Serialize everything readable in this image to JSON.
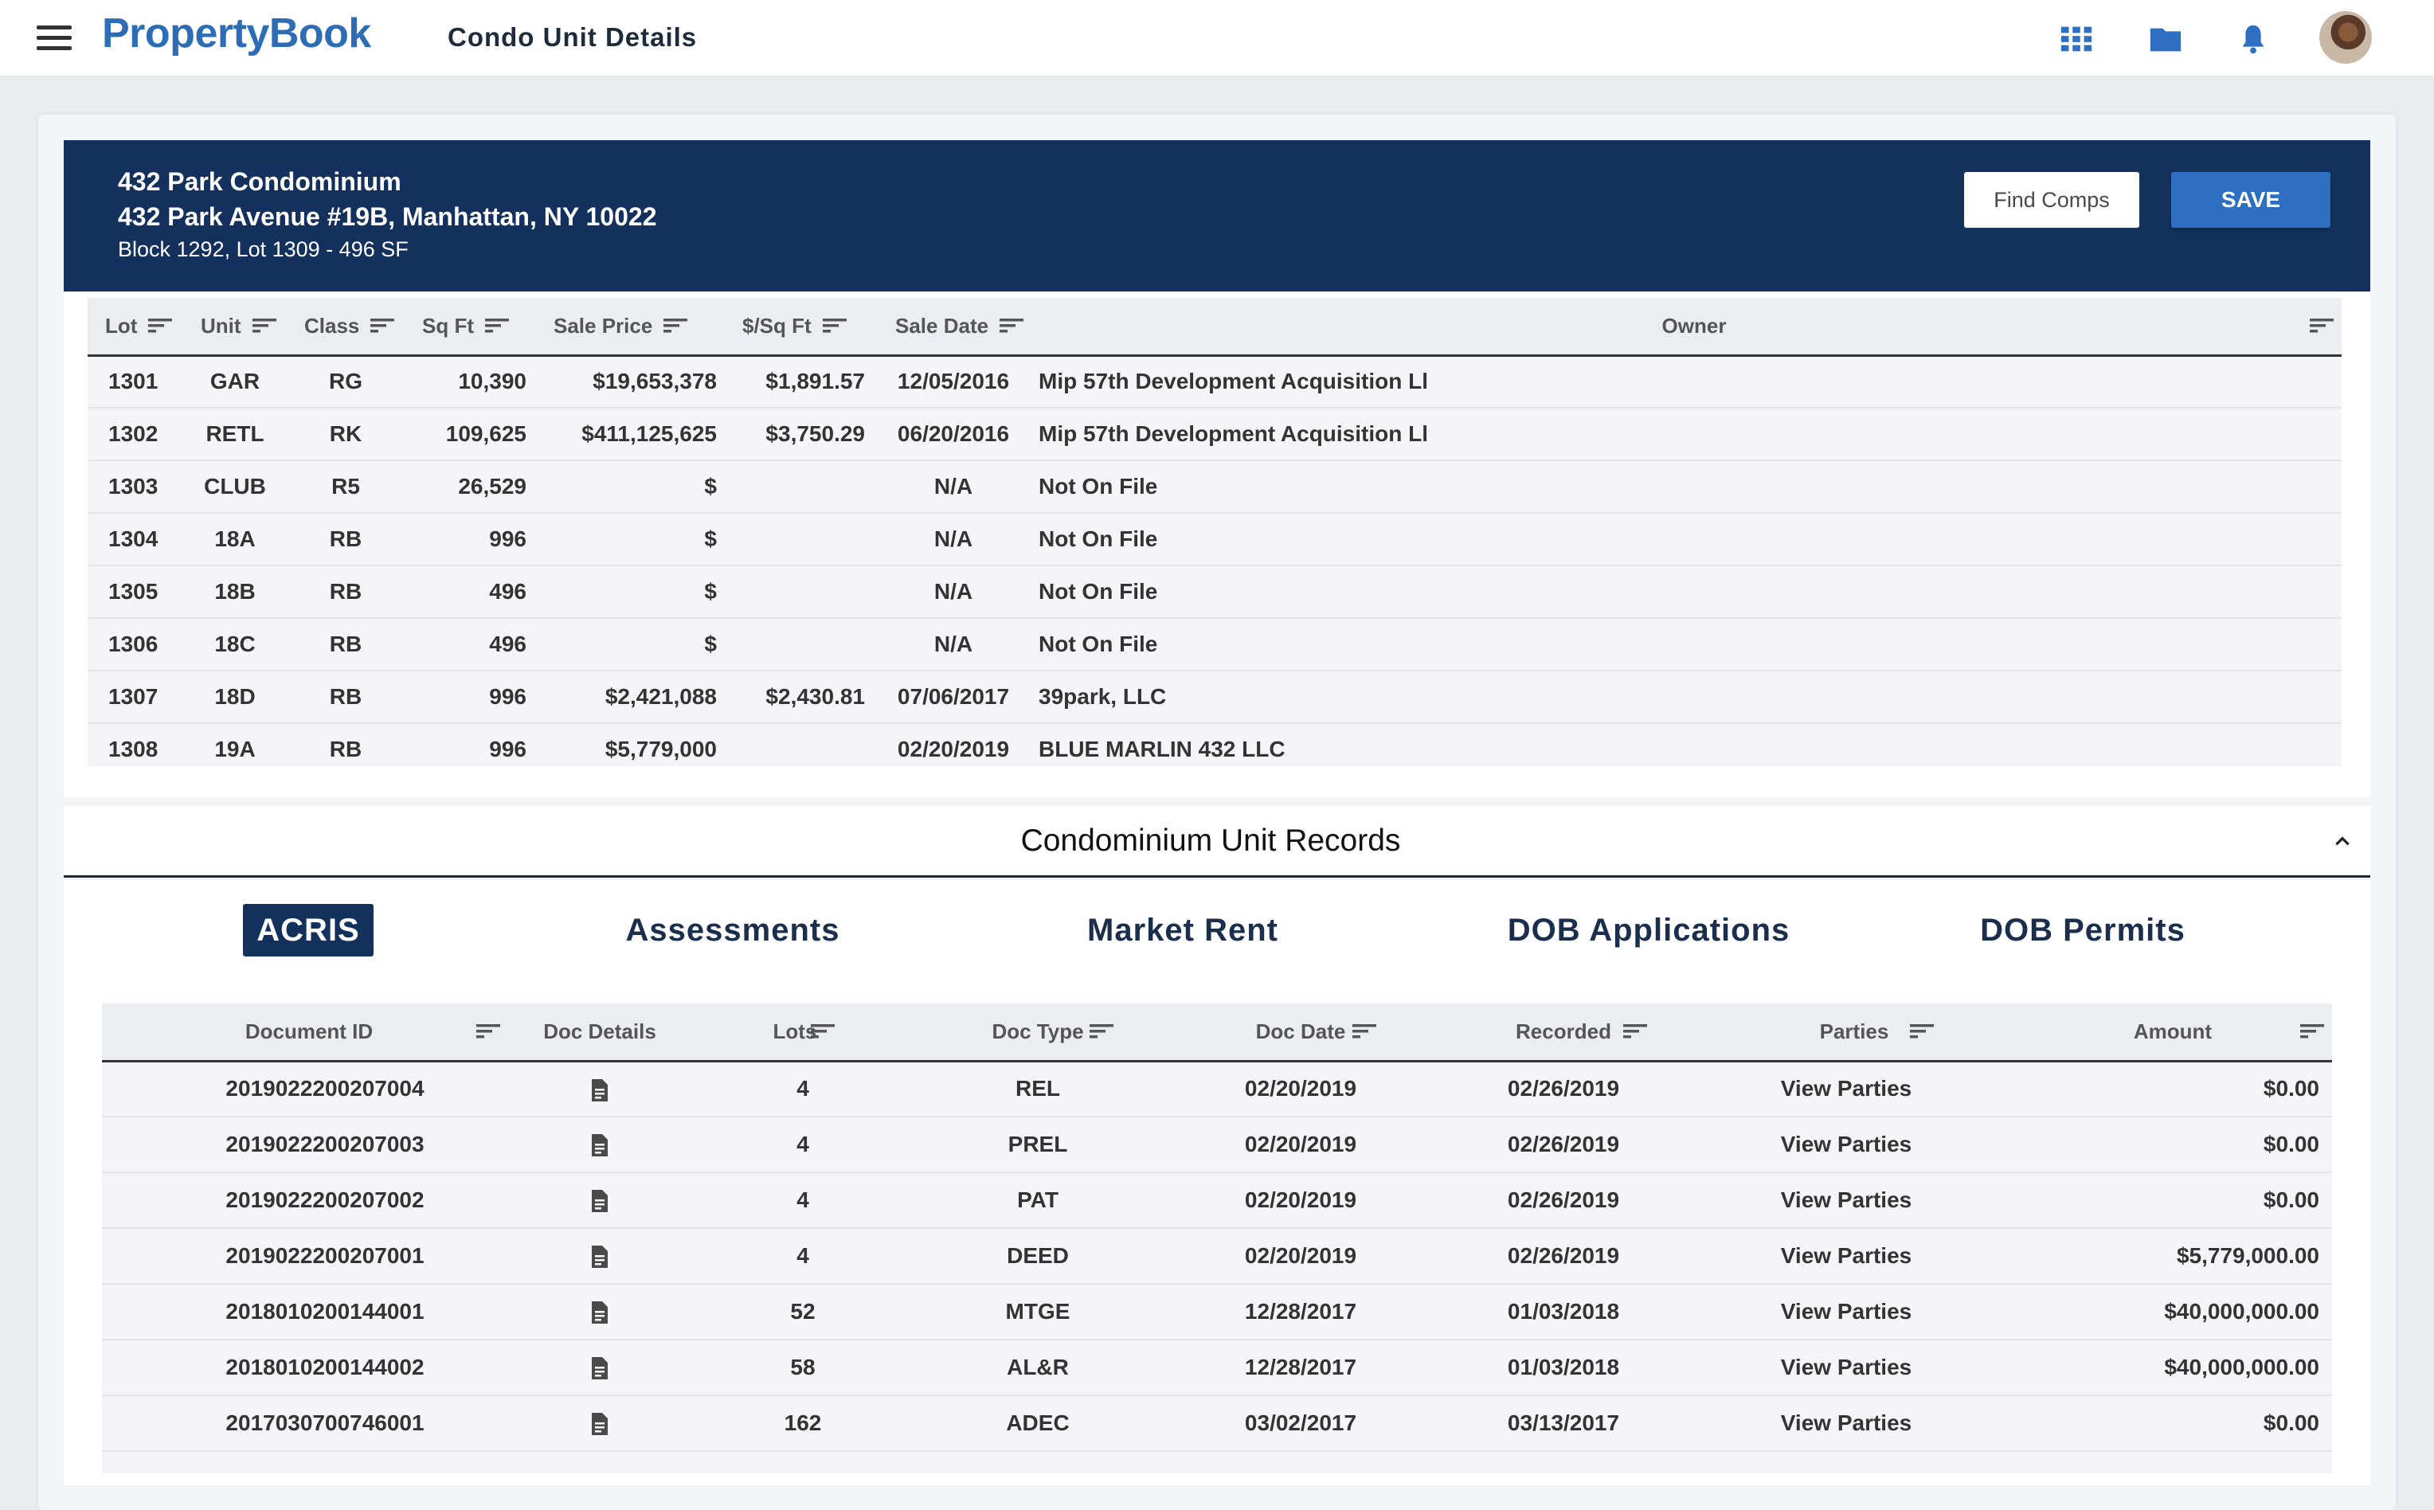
{
  "nav": {
    "brand": "PropertyBook",
    "page_title": "Condo Unit Details",
    "icons": [
      "apps-grid-icon",
      "folder-icon",
      "bell-icon"
    ]
  },
  "property": {
    "name": "432 Park Condominium",
    "address": "432 Park Avenue #19B, Manhattan, NY 10022",
    "meta": "Block 1292, Lot 1309 - 496 SF",
    "find_comps_label": "Find Comps",
    "save_label": "SAVE"
  },
  "units": {
    "columns": [
      "Lot",
      "Unit",
      "Class",
      "Sq Ft",
      "Sale Price",
      "$/Sq Ft",
      "Sale Date",
      "Owner"
    ],
    "rows": [
      {
        "lot": "1301",
        "unit": "GAR",
        "class": "RG",
        "sqft": "10,390",
        "price": "$19,653,378",
        "psf": "$1,891.57",
        "date": "12/05/2016",
        "owner": "Mip 57th Development Acquisition Ll"
      },
      {
        "lot": "1302",
        "unit": "RETL",
        "class": "RK",
        "sqft": "109,625",
        "price": "$411,125,625",
        "psf": "$3,750.29",
        "date": "06/20/2016",
        "owner": "Mip 57th Development Acquisition Ll"
      },
      {
        "lot": "1303",
        "unit": "CLUB",
        "class": "R5",
        "sqft": "26,529",
        "price": "$",
        "psf": "",
        "date": "N/A",
        "owner": "Not On File"
      },
      {
        "lot": "1304",
        "unit": "18A",
        "class": "RB",
        "sqft": "996",
        "price": "$",
        "psf": "",
        "date": "N/A",
        "owner": "Not On File"
      },
      {
        "lot": "1305",
        "unit": "18B",
        "class": "RB",
        "sqft": "496",
        "price": "$",
        "psf": "",
        "date": "N/A",
        "owner": "Not On File"
      },
      {
        "lot": "1306",
        "unit": "18C",
        "class": "RB",
        "sqft": "496",
        "price": "$",
        "psf": "",
        "date": "N/A",
        "owner": "Not On File"
      },
      {
        "lot": "1307",
        "unit": "18D",
        "class": "RB",
        "sqft": "996",
        "price": "$2,421,088",
        "psf": "$2,430.81",
        "date": "07/06/2017",
        "owner": "39park, LLC"
      },
      {
        "lot": "1308",
        "unit": "19A",
        "class": "RB",
        "sqft": "996",
        "price": "$5,779,000",
        "psf": "",
        "date": "02/20/2019",
        "owner": "BLUE MARLIN 432 LLC"
      }
    ]
  },
  "records": {
    "title": "Condominium Unit Records",
    "tabs": [
      "ACRIS",
      "Assessments",
      "Market Rent",
      "DOB Applications",
      "DOB Permits"
    ],
    "active_tab": "ACRIS",
    "columns": [
      "Document ID",
      "Doc Details",
      "Lots",
      "Doc Type",
      "Doc Date",
      "Recorded",
      "Parties",
      "Amount"
    ],
    "rows": [
      {
        "id": "2019022200207004",
        "lots": "4",
        "type": "REL",
        "doc_date": "02/20/2019",
        "recorded": "02/26/2019",
        "parties": "View Parties",
        "amount": "$0.00"
      },
      {
        "id": "2019022200207003",
        "lots": "4",
        "type": "PREL",
        "doc_date": "02/20/2019",
        "recorded": "02/26/2019",
        "parties": "View Parties",
        "amount": "$0.00"
      },
      {
        "id": "2019022200207002",
        "lots": "4",
        "type": "PAT",
        "doc_date": "02/20/2019",
        "recorded": "02/26/2019",
        "parties": "View Parties",
        "amount": "$0.00"
      },
      {
        "id": "2019022200207001",
        "lots": "4",
        "type": "DEED",
        "doc_date": "02/20/2019",
        "recorded": "02/26/2019",
        "parties": "View Parties",
        "amount": "$5,779,000.00"
      },
      {
        "id": "2018010200144001",
        "lots": "52",
        "type": "MTGE",
        "doc_date": "12/28/2017",
        "recorded": "01/03/2018",
        "parties": "View Parties",
        "amount": "$40,000,000.00"
      },
      {
        "id": "2018010200144002",
        "lots": "58",
        "type": "AL&R",
        "doc_date": "12/28/2017",
        "recorded": "01/03/2018",
        "parties": "View Parties",
        "amount": "$40,000,000.00"
      },
      {
        "id": "2017030700746001",
        "lots": "162",
        "type": "ADEC",
        "doc_date": "03/02/2017",
        "recorded": "03/13/2017",
        "parties": "View Parties",
        "amount": "$0.00"
      }
    ]
  },
  "colors": {
    "brand": "#2c6db5",
    "header_navy": "#13315c",
    "save_blue": "#2f6fc2",
    "link_blue": "#2f74c6"
  }
}
